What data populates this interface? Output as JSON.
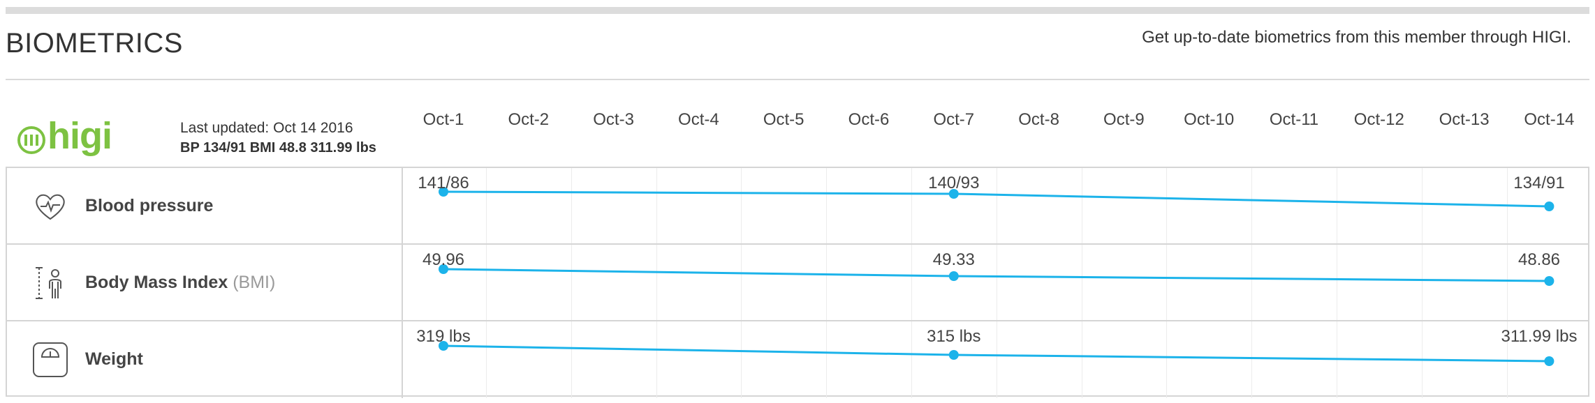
{
  "header": {
    "title": "BIOMETRICS",
    "subtitle": "Get up-to-date biometrics from this member through HIGI."
  },
  "source": {
    "logo_text": "higi",
    "last_updated": "Last updated: Oct 14 2016",
    "summary": "BP 134/91 BMI 48.8 311.99 lbs"
  },
  "dates": [
    "Oct-1",
    "Oct-2",
    "Oct-3",
    "Oct-4",
    "Oct-5",
    "Oct-6",
    "Oct-7",
    "Oct-8",
    "Oct-9",
    "Oct-10",
    "Oct-11",
    "Oct-12",
    "Oct-13",
    "Oct-14"
  ],
  "colors": {
    "series": "#1cb3ea",
    "logo": "#7dc242",
    "grid": "#ececec",
    "border": "#d5d5d5"
  },
  "rows": [
    {
      "label": "Blood pressure",
      "label_suffix": "",
      "icon": "heart-pulse-icon",
      "points": [
        {
          "date": "Oct-1",
          "label": "141/86"
        },
        {
          "date": "Oct-7",
          "label": "140/93"
        },
        {
          "date": "Oct-14",
          "label": "134/91"
        }
      ]
    },
    {
      "label": "Body Mass Index",
      "label_suffix": "(BMI)",
      "icon": "height-person-icon",
      "points": [
        {
          "date": "Oct-1",
          "label": "49.96",
          "value": 49.96
        },
        {
          "date": "Oct-7",
          "label": "49.33",
          "value": 49.33
        },
        {
          "date": "Oct-14",
          "label": "48.86",
          "value": 48.86
        }
      ]
    },
    {
      "label": "Weight",
      "label_suffix": "",
      "icon": "scale-icon",
      "points": [
        {
          "date": "Oct-1",
          "label": "319 lbs",
          "value": 319
        },
        {
          "date": "Oct-7",
          "label": "315 lbs",
          "value": 315
        },
        {
          "date": "Oct-14",
          "label": "311.99 lbs",
          "value": 311.99
        }
      ]
    }
  ]
}
